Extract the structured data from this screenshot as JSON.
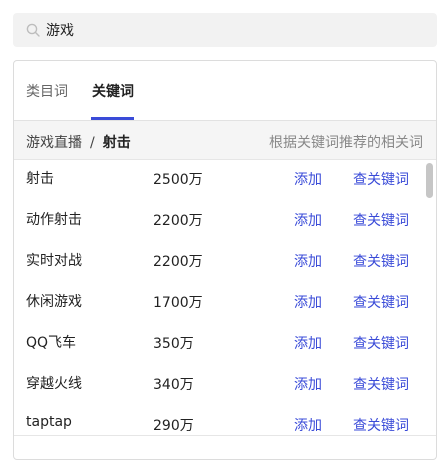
{
  "search": {
    "value": "游戏",
    "icon": "search-icon"
  },
  "tabs": [
    {
      "label": "类目词",
      "active": false
    },
    {
      "label": "关键词",
      "active": true
    }
  ],
  "breadcrumb": {
    "parent": "游戏直播",
    "separator": "/",
    "current": "射击"
  },
  "hint": "根据关键词推荐的相关词",
  "rows": [
    {
      "name": "射击",
      "count": "2500万",
      "add": "添加",
      "check": "查关键词"
    },
    {
      "name": "动作射击",
      "count": "2200万",
      "add": "添加",
      "check": "查关键词"
    },
    {
      "name": "实时对战",
      "count": "2200万",
      "add": "添加",
      "check": "查关键词"
    },
    {
      "name": "休闲游戏",
      "count": "1700万",
      "add": "添加",
      "check": "查关键词"
    },
    {
      "name": "QQ飞车",
      "count": "350万",
      "add": "添加",
      "check": "查关键词"
    },
    {
      "name": "穿越火线",
      "count": "340万",
      "add": "添加",
      "check": "查关键词"
    },
    {
      "name": "taptap",
      "count": "290万",
      "add": "添加",
      "check": "查关键词"
    }
  ],
  "colors": {
    "accent": "#3a4bd8",
    "hint": "#888888",
    "search_bg": "#f2f2f2"
  }
}
